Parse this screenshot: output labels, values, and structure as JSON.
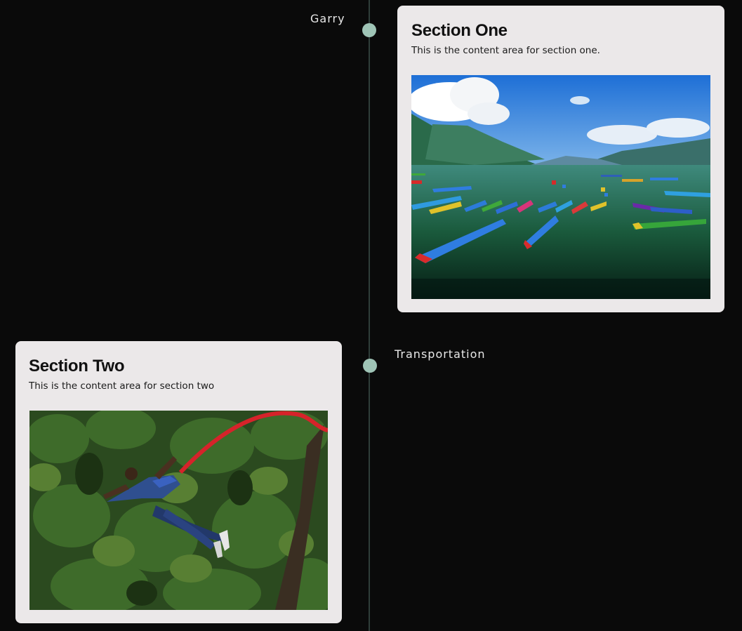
{
  "timeline": {
    "entries": [
      {
        "label": "Garry",
        "card": {
          "title": "Section One",
          "text": "This is the content area for section one.",
          "image_alt": "Lake with colorful boats and mountains"
        }
      },
      {
        "label": "Transportation",
        "card": {
          "title": "Section Two",
          "text": "This is the content area for section two",
          "image_alt": "Bungee jumper over forest"
        }
      }
    ]
  },
  "colors": {
    "background": "#0a0a0a",
    "line": "#2f3d39",
    "dot": "#9fc4b6",
    "card": "#ebe8e9"
  }
}
